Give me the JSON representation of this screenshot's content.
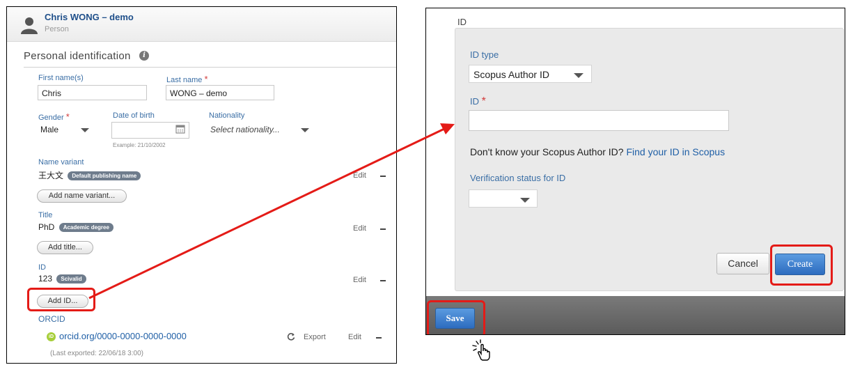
{
  "person": {
    "name": "Chris WONG – demo",
    "type": "Person"
  },
  "personal_identification": {
    "title": "Personal identification",
    "first_name_label": "First name(s)",
    "first_name_value": "Chris",
    "last_name_label": "Last name",
    "last_name_value": "WONG – demo",
    "gender_label": "Gender",
    "gender_value": "Male",
    "dob_label": "Date of birth",
    "dob_example": "Example: 21/10/2002",
    "nationality_label": "Nationality",
    "nationality_placeholder": "Select nationality...",
    "name_variant_label": "Name variant",
    "name_variant_value": "王大文",
    "name_variant_badge": "Default publishing name",
    "add_name_variant": "Add name variant...",
    "title_label": "Title",
    "title_value": "PhD",
    "title_badge": "Academic degree",
    "add_title": "Add title...",
    "id_label": "ID",
    "id_value": "123",
    "id_badge": "Scivalid",
    "add_id": "Add ID...",
    "orcid_label": "ORCID",
    "orcid_prefix": "orcid.org/",
    "orcid_value": "0000-0000-0000-0000",
    "orcid_export": "Export",
    "orcid_last_exported": "(Last exported: 22/06/18 3:00)",
    "edit_label": "Edit"
  },
  "dialog": {
    "title": "ID",
    "id_type_label": "ID type",
    "id_type_value": "Scopus Author ID",
    "id_label": "ID",
    "scopus_question": "Don't know your Scopus Author ID?",
    "scopus_link": "Find your ID in Scopus",
    "verification_label": "Verification status for ID",
    "cancel": "Cancel",
    "create": "Create",
    "save": "Save"
  },
  "colors": {
    "highlight": "#e41b17",
    "link": "#1f5fa6",
    "primary_button": "#2d6cbf",
    "orcid_green": "#a6ce39"
  }
}
